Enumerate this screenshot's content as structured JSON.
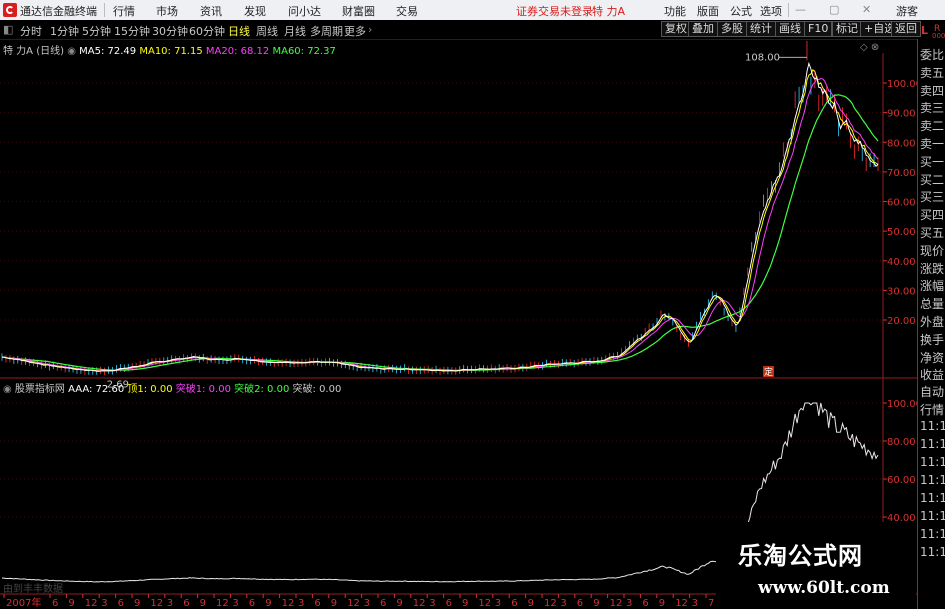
{
  "titlebar": {
    "app_name": "通达信金融终端",
    "menu": [
      "行情",
      "市场",
      "资讯",
      "发现",
      "问小达",
      "财富圈",
      "交易"
    ],
    "login_warning": "证券交易未登录",
    "stock_title": "特 力A",
    "right_menu": [
      "功能",
      "版面",
      "公式",
      "选项"
    ],
    "guest": "游客"
  },
  "toolbar": {
    "periods": [
      "分时",
      "1分钟",
      "5分钟",
      "15分钟",
      "30分钟",
      "60分钟",
      "日线",
      "周线",
      "月线",
      "多周期",
      "更多"
    ],
    "active_period": "日线",
    "buttons": [
      "复权",
      "叠加",
      "多股",
      "统计",
      "画线",
      "F10",
      "标记",
      "+自选",
      "返回"
    ]
  },
  "main_legend": {
    "name": "特 力A",
    "period": "(日线)",
    "ma5": "MA5: 72.49",
    "ma10": "MA10: 71.15",
    "ma20": "MA20: 68.12",
    "ma60": "MA60: 72.37"
  },
  "sub_legend": {
    "name": "股票指标网",
    "aaa": "AAA: 72.60",
    "ding1": "顶1: 0.00",
    "tupo1": "突破1: 0.00",
    "tupo2": "突破2: 0.00",
    "tupo": "突破: 0.00"
  },
  "annotations": {
    "high_label": "108.00",
    "low_label": "2.69",
    "marker": "定",
    "watermark_faint": "由到丰丰数据"
  },
  "right_panel": {
    "corner_top": "L",
    "corner_r": "R",
    "corner_small": "000",
    "items": [
      "委比",
      "卖五",
      "卖四",
      "卖三",
      "卖二",
      "卖一",
      "买一",
      "买二",
      "买三",
      "买四",
      "买五",
      "现价",
      "涨跌",
      "涨幅",
      "总量",
      "外盘",
      "换手",
      "净资",
      "收益"
    ],
    "lower_items": [
      "自动",
      "行情",
      "11:1",
      "11:1",
      "11:1",
      "11:1",
      "11:1",
      "11:1",
      "11:1",
      "11:1"
    ]
  },
  "watermark": {
    "cn": "乐淘公式网",
    "url": "www.60lt.com"
  },
  "colors": {
    "ma5": "#ffffff",
    "ma10": "#ffff00",
    "ma20": "#ff40ff",
    "ma60": "#40ff40",
    "axis": "#d83030"
  },
  "chart_data": [
    {
      "type": "line",
      "title": "特 力A (日线)",
      "y_ticks": [
        20.0,
        30.0,
        40.0,
        50.0,
        60.0,
        70.0,
        80.0,
        90.0,
        100.0
      ],
      "ylim": [
        0,
        108
      ],
      "x_ticks": [
        "2007年",
        "6",
        "9",
        "12",
        "3",
        "6",
        "9",
        "12",
        "3",
        "6",
        "9",
        "12",
        "3",
        "6",
        "9",
        "12",
        "3",
        "6",
        "9",
        "12",
        "3",
        "6",
        "9",
        "12",
        "3",
        "6",
        "9",
        "12",
        "3",
        "6",
        "9",
        "12",
        "3",
        "6",
        "9",
        "12",
        "3",
        "6",
        "9",
        "12",
        "3",
        "7"
      ],
      "price": [
        7.5,
        6.0,
        4.5,
        3.5,
        2.69,
        3.5,
        5.0,
        6.5,
        7.5,
        6.5,
        7.0,
        6.0,
        5.5,
        6.0,
        5.5,
        4.0,
        3.5,
        3.5,
        3.0,
        3.0,
        3.5,
        3.5,
        4.0,
        5.0,
        5.5,
        6.0,
        8.0,
        15.0,
        22.0,
        12.0,
        30.0,
        18.0,
        55.0,
        75.0,
        108.0,
        90.0,
        80.0,
        72.6
      ],
      "series": [
        {
          "name": "MA5",
          "last": 72.49
        },
        {
          "name": "MA10",
          "last": 71.15
        },
        {
          "name": "MA20",
          "last": 68.12
        },
        {
          "name": "MA60",
          "last": 72.37
        }
      ]
    },
    {
      "type": "line",
      "title": "股票指标网",
      "y_ticks": [
        40.0,
        60.0,
        80.0,
        100.0
      ],
      "series": [
        {
          "name": "AAA",
          "last": 72.6
        }
      ]
    }
  ]
}
